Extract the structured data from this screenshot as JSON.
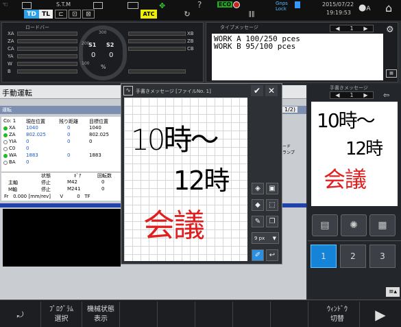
{
  "status": {
    "stm": "S.T.M",
    "atc": "ATC",
    "eco": "ECO",
    "gnss": "Gnps\nLock",
    "date": "2015/07/22",
    "time": "19:19:53",
    "user": "A",
    "modes": [
      "TD",
      "TL"
    ]
  },
  "gauge": {
    "title": "ロードバー",
    "left_axes": [
      "XA",
      "ZA",
      "CA",
      "YA",
      "W",
      "B"
    ],
    "right_axes": [
      "XB",
      "ZB",
      "CB"
    ],
    "s1": "S1",
    "s2": "S2",
    "s1_val": "0",
    "s2_val": "0",
    "pct": "%",
    "scale_200": "200",
    "scale_300": "300",
    "scale_100": "100",
    "scale_0": "0"
  },
  "message": {
    "title": "タイプメッセージ",
    "page": "1",
    "lines": [
      "WORK A 100/250 pces",
      "WORK B 95/100 pces"
    ]
  },
  "manual": {
    "title": "手動運転",
    "sub": "運転",
    "page": "1/2)",
    "cols": [
      "現在位置",
      "残り距離",
      "目標位置"
    ],
    "co_label": "Co:",
    "co_val": "1",
    "rows": [
      {
        "axis": "XA",
        "cur": "1040",
        "rem": "0",
        "tgt": "1040"
      },
      {
        "axis": "ZA",
        "cur": "802.025",
        "rem": "0",
        "tgt": "802.025"
      },
      {
        "axis": "YIA",
        "cur": "0",
        "rem": "0",
        "tgt": "0"
      },
      {
        "axis": "C0",
        "cur": "0",
        "rem": "",
        "tgt": ""
      },
      {
        "axis": "WA",
        "cur": "1883",
        "rem": "0",
        "tgt": "1883"
      },
      {
        "axis": "BA",
        "cur": "0",
        "rem": "",
        "tgt": ""
      }
    ],
    "spindle_cols": [
      "状態",
      "ｷﾞｱ",
      "回転数"
    ],
    "spindle_rows": [
      {
        "name": "主軸",
        "state": "停止",
        "gear": "M42",
        "rpm": "0"
      },
      {
        "name": "M軸",
        "state": "停止",
        "gear": "M241",
        "rpm": "0"
      }
    ],
    "fr_label": "Fr",
    "fr_val": "0.000",
    "fr_unit": "[mm/rev]",
    "v_label": "V",
    "v_val": "0",
    "tf": "TF",
    "side_text_1": "ード",
    "side_text_2": "ランプ"
  },
  "handwriting": {
    "title": "手書きメッセージ [ファイルNo. 1]",
    "line1": "10時～",
    "line2": "12時",
    "line3": "会議",
    "pen_size": "9 px"
  },
  "right_panel": {
    "title": "手書きメッセージ",
    "page": "1",
    "line1": "10時～",
    "line2": "12時",
    "line3": "会議",
    "tabs": [
      "1",
      "2",
      "3"
    ]
  },
  "softkeys": [
    {
      "top": "ﾌﾟﾛｸﾞﾗﾑ",
      "bottom": "選択"
    },
    {
      "top": "機械状態",
      "bottom": "表示"
    },
    {
      "top": "ｳｨﾝﾄﾞｳ",
      "bottom": "切替"
    }
  ]
}
